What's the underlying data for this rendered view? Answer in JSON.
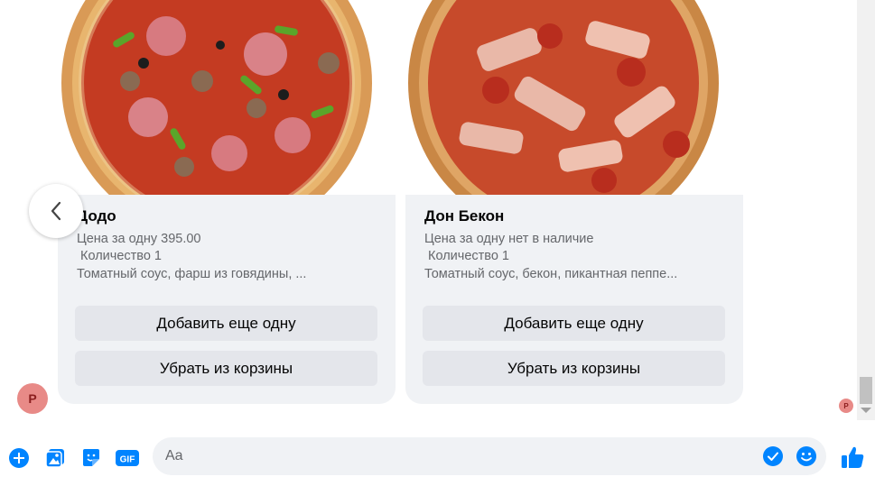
{
  "carousel": {
    "cards": [
      {
        "title": "Додо",
        "price_line": "Цена за одну 395.00",
        "quantity_line": "Количество 1",
        "description": "Томатный соус, фарш из говядины, ...",
        "add_button": "Добавить еще одну",
        "remove_button": "Убрать из корзины"
      },
      {
        "title": "Дон Бекон",
        "price_line": "Цена за одну нет в наличие",
        "quantity_line": "Количество 1",
        "description": "Томатный соус, бекон, пикантная пеппе...",
        "add_button": "Добавить еще одну",
        "remove_button": "Убрать из корзины"
      }
    ],
    "prev_icon": "chevron-left-icon"
  },
  "sender": {
    "avatar_letter": "P",
    "avatar_color": "#e88a87"
  },
  "composer": {
    "placeholder": "Aa",
    "gif_label": "GIF",
    "icons": [
      "plus-icon",
      "photo-icon",
      "sticker-icon",
      "gif-icon",
      "checkmark-icon",
      "emoji-icon",
      "like-icon"
    ]
  },
  "colors": {
    "accent": "#0084ff",
    "card_bg": "#f0f2f5",
    "button_bg": "#e4e6eb"
  }
}
